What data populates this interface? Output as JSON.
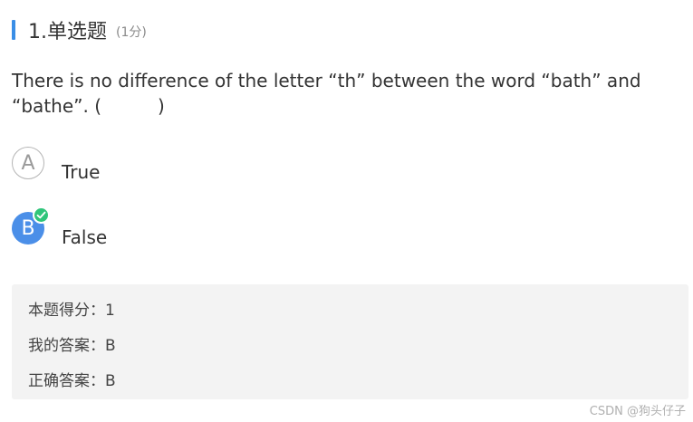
{
  "question": {
    "number_title": "1.单选题",
    "score": "(1分)",
    "text_before_blank": "There is no difference of the letter “th” between the word “bath” and “bathe”. (",
    "text_after_blank": ")"
  },
  "options": [
    {
      "letter": "A",
      "label": "True",
      "selected": false
    },
    {
      "letter": "B",
      "label": "False",
      "selected": true
    }
  ],
  "answer_panel": {
    "score_line": "本题得分：1",
    "my_answer_line": "我的答案：B",
    "correct_answer_line": "正确答案：B"
  },
  "watermark": "CSDN @狗头仔子",
  "colors": {
    "accent_bar": "#3a8ee6",
    "selected_option": "#4b8fe8",
    "correct_check": "#2fc57a",
    "panel_bg": "#f3f3f3"
  },
  "icons": {
    "correct": "checkmark-icon"
  }
}
